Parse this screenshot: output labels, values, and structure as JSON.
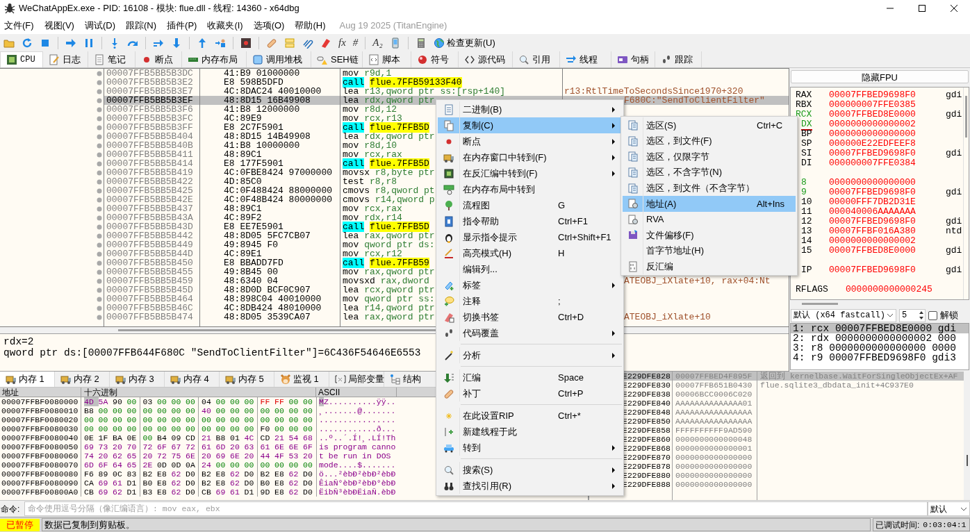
{
  "window": {
    "title": "WeChatAppEx.exe - PID: 16108 - 模块: flue.dll - 线程: 14360 - x64dbg"
  },
  "menu_bar": {
    "items": [
      "文件(F)",
      "视图(V)",
      "调试(D)",
      "跟踪(N)",
      "插件(P)",
      "收藏夹(I)",
      "选项(O)",
      "帮助(H)"
    ],
    "build_info": "Aug 19 2025 (TitanEngine)"
  },
  "toolbar": {
    "glyphs": [
      "fx",
      "#",
      "A₂"
    ],
    "update_button": "检查更新(U)"
  },
  "tabs": [
    {
      "label": "CPU",
      "selected": true
    },
    {
      "label": "日志",
      "selected": false
    },
    {
      "label": "笔记",
      "selected": false
    },
    {
      "label": "断点",
      "selected": false
    },
    {
      "label": "内存布局",
      "selected": false
    },
    {
      "label": "调用堆栈",
      "selected": false
    },
    {
      "label": "SEH链",
      "selected": false
    },
    {
      "label": "脚本",
      "selected": false
    },
    {
      "label": "符号",
      "selected": false
    },
    {
      "label": "源代码",
      "selected": false
    },
    {
      "label": "引用",
      "selected": false
    },
    {
      "label": "线程",
      "selected": false
    },
    {
      "label": "句柄",
      "selected": false
    },
    {
      "label": "跟踪",
      "selected": false
    }
  ],
  "disassembly": {
    "rows": [
      {
        "address": "00007FFB5BB5B3DC",
        "bytes": "41:B9 01000000",
        "kind": "plain",
        "mnemonic": "mov",
        "operands": "r9d,1",
        "selected": false
      },
      {
        "address": "00007FFB5BB5B3E2",
        "bytes": "E8 598B5DFD",
        "kind": "call",
        "mnemonic": "call",
        "operands": "flue.7FFB59133F40",
        "selected": false
      },
      {
        "address": "00007FFB5BB5B3E7",
        "bytes": "4C:8DAC24 40010000",
        "kind": "plain",
        "mnemonic": "lea",
        "operands": "r13,qword ptr ss:[rsp+140]",
        "comment": "r13:RtlTimeToSecondsSince1970+320",
        "selected": false
      },
      {
        "address": "00007FFB5BB5B3EF",
        "bytes": "48:8D15 16B49908",
        "kind": "plain",
        "mnemonic": "lea",
        "operands": "rdx,qword ptr",
        "comment": "F680C:\"SendToClientFilter\"",
        "selected": true
      },
      {
        "address": "00007FFB5BB5B3F6",
        "bytes": "41:B8 12000000",
        "kind": "plain",
        "mnemonic": "mov",
        "operands": "r8d,12",
        "selected": false
      },
      {
        "address": "00007FFB5BB5B3FC",
        "bytes": "4C:89E9",
        "kind": "plain",
        "mnemonic": "mov",
        "operands": "rcx,r13",
        "selected": false
      },
      {
        "address": "00007FFB5BB5B3FF",
        "bytes": "E8 2C7F5901",
        "kind": "call",
        "mnemonic": "call",
        "operands": "flue.7FFB5D",
        "selected": false
      },
      {
        "address": "00007FFB5BB5B404",
        "bytes": "48:8D15 14B49908",
        "kind": "plain",
        "mnemonic": "lea",
        "operands": "rdx,qword ptr",
        "selected": false
      },
      {
        "address": "00007FFB5BB5B40B",
        "bytes": "41:B8 10000000",
        "kind": "plain",
        "mnemonic": "mov",
        "operands": "r8d,10",
        "selected": false
      },
      {
        "address": "00007FFB5BB5B411",
        "bytes": "48:89C1",
        "kind": "plain",
        "mnemonic": "mov",
        "operands": "rcx,rax",
        "selected": false
      },
      {
        "address": "00007FFB5BB5B414",
        "bytes": "E8 177F5901",
        "kind": "call",
        "mnemonic": "call",
        "operands": "flue.7FFB5D",
        "selected": false
      },
      {
        "address": "00007FFB5BB5B419",
        "bytes": "4C:0FBE8424 97000000",
        "kind": "plain",
        "mnemonic": "movsx",
        "operands": "r8,byte ptr",
        "selected": false
      },
      {
        "address": "00007FFB5BB5B422",
        "bytes": "4D:85C0",
        "kind": "plain",
        "mnemonic": "test",
        "operands": "r8,r8",
        "selected": false
      },
      {
        "address": "00007FFB5BB5B425",
        "bytes": "4C:0F488424 88000000",
        "kind": "plain",
        "mnemonic": "cmovs",
        "operands": "r8,qword pt",
        "selected": false
      },
      {
        "address": "00007FFB5BB5B42E",
        "bytes": "4C:0F48B424 80000000",
        "kind": "plain",
        "mnemonic": "cmovs",
        "operands": "r14,qword p",
        "selected": false
      },
      {
        "address": "00007FFB5BB5B437",
        "bytes": "48:89C1",
        "kind": "plain",
        "mnemonic": "mov",
        "operands": "rcx,rax",
        "selected": false
      },
      {
        "address": "00007FFB5BB5B43A",
        "bytes": "4C:89F2",
        "kind": "plain",
        "mnemonic": "mov",
        "operands": "rdx,r14",
        "selected": false
      },
      {
        "address": "00007FFB5BB5B43D",
        "bytes": "E8 EE7E5901",
        "kind": "call",
        "mnemonic": "call",
        "operands": "flue.7FFB5D",
        "selected": false
      },
      {
        "address": "00007FFB5BB5B442",
        "bytes": "48:8D05 5FC7CB07",
        "kind": "plain",
        "mnemonic": "lea",
        "operands": "rax,qword ptr",
        "selected": false
      },
      {
        "address": "00007FFB5BB5B449",
        "bytes": "49:8945 F0",
        "kind": "plain",
        "mnemonic": "mov",
        "operands": "qword ptr ds:",
        "selected": false
      },
      {
        "address": "00007FFB5BB5B44D",
        "bytes": "4C:89E1",
        "kind": "plain",
        "mnemonic": "mov",
        "operands": "rcx,r12",
        "selected": false
      },
      {
        "address": "00007FFB5BB5B450",
        "bytes": "E8 BBADD7FD",
        "kind": "call",
        "mnemonic": "call",
        "operands": "flue.7FFB59",
        "selected": false
      },
      {
        "address": "00007FFB5BB5B455",
        "bytes": "49:8B45 00",
        "kind": "plain",
        "mnemonic": "mov",
        "operands": "rax,qword ptr",
        "selected": false
      },
      {
        "address": "00007FFB5BB5B459",
        "bytes": "48:6340 04",
        "kind": "plain",
        "mnemonic": "movsxd",
        "operands": "rax,dword",
        "comment": "ATEOBJ_iXlate+10, rax+04:Nt",
        "selected": false
      },
      {
        "address": "00007FFB5BB5B45D",
        "bytes": "48:8D0D BCF0C907",
        "kind": "plain",
        "mnemonic": "lea",
        "operands": "rcx,qword ptr",
        "selected": false
      },
      {
        "address": "00007FFB5BB5B464",
        "bytes": "48:898C04 40010000",
        "kind": "plain",
        "mnemonic": "mov",
        "operands": "qword ptr ss:",
        "selected": false
      },
      {
        "address": "00007FFB5BB5B46C",
        "bytes": "4C:8DB424 48010000",
        "kind": "plain",
        "mnemonic": "lea",
        "operands": "r14,qword ptr",
        "selected": false
      },
      {
        "address": "00007FFB5BB5B474",
        "bytes": "48:8D05 3539CA07",
        "kind": "plain",
        "mnemonic": "lea",
        "operands": "rax,qword ptr",
        "comment": "ATEOBJ_iXlate+10",
        "selected": false
      }
    ]
  },
  "registers": {
    "fpu_button": "隐藏FPU",
    "groups": [
      {
        "rows": [
          {
            "name": "RAX",
            "value": "00007FFBED9698F0",
            "comment": "gdi",
            "highlighted": false,
            "selected": false,
            "changed": true
          },
          {
            "name": "RBX",
            "value": "000000007FFE0385",
            "highlighted": false,
            "selected": false,
            "changed": true
          },
          {
            "name": "RCX",
            "value": "00007FFBED8E0000",
            "comment": "gdi",
            "highlighted": true,
            "selected": false,
            "changed": true
          },
          {
            "name": "DX",
            "value": "0000000000000002",
            "highlighted": true,
            "selected": true,
            "changed": true
          },
          {
            "name": "BP",
            "value": "0000000000000000",
            "highlighted": false,
            "selected": false,
            "changed": true
          },
          {
            "name": "SP",
            "value": "000000E22EDFEEF8",
            "highlighted": false,
            "selected": false,
            "changed": true
          },
          {
            "name": "SI",
            "value": "00007FFBED9698F0",
            "comment": "gdi",
            "highlighted": false,
            "selected": false,
            "changed": true
          },
          {
            "name": "DI",
            "value": "000000007FFE0384",
            "highlighted": false,
            "selected": false,
            "changed": true
          }
        ]
      },
      {
        "rows": [
          {
            "name": "8",
            "value": "0000000000000000",
            "highlighted": true,
            "selected": false,
            "changed": true
          },
          {
            "name": "9",
            "value": "00007FFBED9698F0",
            "comment": "gdi",
            "highlighted": true,
            "selected": false,
            "changed": true
          },
          {
            "name": "10",
            "value": "00000FFF7DB2D31E",
            "highlighted": false,
            "selected": false,
            "changed": true
          },
          {
            "name": "11",
            "value": "000040006AAAAAAA",
            "highlighted": false,
            "selected": false,
            "changed": true
          },
          {
            "name": "12",
            "value": "00007FFBED9698F0",
            "comment": "gdi",
            "highlighted": false,
            "selected": false,
            "changed": true
          },
          {
            "name": "13",
            "value": "00007FFBF016A380",
            "comment": "ntd",
            "highlighted": false,
            "selected": false,
            "changed": true
          },
          {
            "name": "14",
            "value": "0000000000000002",
            "highlighted": false,
            "selected": false,
            "changed": true
          },
          {
            "name": "15",
            "value": "00007FFBED8E0000",
            "comment": "gdi",
            "highlighted": false,
            "selected": false,
            "changed": true
          }
        ]
      },
      {
        "rows": [
          {
            "name": "IP",
            "value": "00007FFBED9698F0",
            "comment": "gdi",
            "highlighted": false,
            "selected": false,
            "changed": true
          }
        ]
      }
    ],
    "flags": {
      "name": "RFLAGS",
      "value": "0000000000000245"
    }
  },
  "call_convention": {
    "value": "默认 (x64 fastcall)",
    "count": "5",
    "unlock": {
      "label": "解锁",
      "checked": false
    },
    "args": [
      {
        "text": "1: rcx 00007FFBED8E0000 gdi",
        "selected": true
      },
      {
        "text": "2: rdx 0000000000000002 000",
        "selected": false
      },
      {
        "text": "3: r8 0000000000000000 0000",
        "selected": false
      },
      {
        "text": "4: r9 00007FFBED9698F0 gdi3",
        "selected": false
      }
    ]
  },
  "info_pane": {
    "lines": [
      "rdx=2",
      "qword ptr ds:[00007FFB644F680C \"SendToClientFilter\"]=6C436F54646E6553"
    ]
  },
  "memory_tabs": [
    {
      "label": "内存 1",
      "selected": true
    },
    {
      "label": "内存 2",
      "selected": false
    },
    {
      "label": "内存 3",
      "selected": false
    },
    {
      "label": "内存 4",
      "selected": false
    },
    {
      "label": "内存 5",
      "selected": false
    },
    {
      "label": "监视 1",
      "selected": false
    },
    {
      "label": "局部变量",
      "selected": false
    },
    {
      "label": "结构",
      "selected": false
    }
  ],
  "hex_dump": {
    "columns": [
      "地址",
      "十六进制",
      "ASCII"
    ],
    "rows": [
      {
        "address": "00007FFBF0080000",
        "bytes": "4D 5A 90 00 03 00 00 00 04 00 00 00 FF FF 00 00",
        "ascii": "MZ..........ÿÿ..",
        "cursor": true
      },
      {
        "address": "00007FFBF0080010",
        "bytes": "B8 00 00 00 00 00 00 00 40 00 00 00 00 00 00 00",
        "ascii": "¸.......@.......",
        "cursor": false
      },
      {
        "address": "00007FFBF0080020",
        "bytes": "00 00 00 00 00 00 00 00 00 00 00 00 00 00 00 00",
        "ascii": "................",
        "cursor": false
      },
      {
        "address": "00007FFBF0080030",
        "bytes": "00 00 00 00 00 00 00 00 00 00 00 00 F0 00 00 00",
        "ascii": "............ð...",
        "cursor": false
      },
      {
        "address": "00007FFBF0080040",
        "bytes": "0E 1F BA 0E 00 B4 09 CD 21 B8 01 4C CD 21 54 68",
        "ascii": "..º..´.Í!¸.LÍ!Th",
        "cursor": false
      },
      {
        "address": "00007FFBF0080050",
        "bytes": "69 73 20 70 72 6F 67 72 61 6D 20 63 61 6E 6E 6F",
        "ascii": "is program canno",
        "cursor": false
      },
      {
        "address": "00007FFBF0080060",
        "bytes": "74 20 62 65 20 72 75 6E 20 69 6E 20 44 4F 53 20",
        "ascii": "t be run in DOS",
        "cursor": false
      },
      {
        "address": "00007FFBF0080070",
        "bytes": "6D 6F 64 65 2E 0D 0D 0A 24 00 00 00 00 00 00 00",
        "ascii": "mode....$.......",
        "cursor": false
      },
      {
        "address": "00007FFBF0080080",
        "bytes": "F6 89 0C 83 B2 E8 62 D0 B2 E8 62 D0 B2 E8 62 D0",
        "ascii": "ö...²èbÐ²èbÐ²èbÐ",
        "cursor": false
      },
      {
        "address": "00007FFBF0080090",
        "bytes": "CA 69 61 D1 B0 E8 62 D0 B2 E8 62 D0 B0 E8 62 D0",
        "ascii": "ÊiaÑ°èbÐ²èbÐ°èbÐ",
        "cursor": false
      },
      {
        "address": "00007FFBF00800A0",
        "bytes": "CB 69 62 D1 B3 E8 62 D0 CB 69 61 D1 9D E8 62 D0",
        "ascii": "ËibÑ³èbÐËiaÑ.èbÐ",
        "cursor": false
      }
    ]
  },
  "stack": {
    "rows": [
      {
        "address": "E229DFE828",
        "value": "00007FFBED4F895F",
        "comment": "返回到 kernelbase.WaitForSingleObjectEx+AF",
        "selected": true
      },
      {
        "address": "E229DFE830",
        "value": "00007FFB651B0430",
        "comment": "flue.sqlite3_dbdata_init+4C937E0",
        "selected": false
      },
      {
        "address": "E229DFE838",
        "value": "00006BCC0006C020",
        "selected": false
      },
      {
        "address": "E229DFE840",
        "value": "AAAAAAAAAAAAAA01",
        "selected": false
      },
      {
        "address": "E229DFE848",
        "value": "AAAAAAAAAAAAAAAA",
        "selected": false
      },
      {
        "address": "E229DFE850",
        "value": "AAAAAAAAAAAAAAAA",
        "selected": false
      },
      {
        "address": "E229DFE858",
        "value": "FFFFFFFFFF9AD590",
        "selected": false
      },
      {
        "address": "E229DFE860",
        "value": "0000000000000048",
        "selected": false
      },
      {
        "address": "E229DFE868",
        "value": "0000000000000001",
        "selected": false
      },
      {
        "address": "E229DFE870",
        "value": "0000000000000000",
        "selected": false
      },
      {
        "address": "E229DFE878",
        "value": "0000000000000000",
        "selected": false
      },
      {
        "address": "E229DFE880",
        "value": "0000000000000000",
        "selected": false
      },
      {
        "address": "E229DFE888",
        "value": "0000000000000000",
        "selected": false
      }
    ]
  },
  "command_bar": {
    "label": "命令:",
    "placeholder": "命令使用逗号分隔（像汇编语言）: mov eax, ebx",
    "mode": "默认"
  },
  "status_bar": {
    "state": "已暂停",
    "message": "数据已复制到剪贴板。",
    "elapsed_label": "已调试时间:",
    "elapsed": "0:03:04:1"
  },
  "context_menu": {
    "items": [
      {
        "kind": "item",
        "label": "二进制(B)",
        "submenu": true,
        "selected": false
      },
      {
        "kind": "item",
        "label": "复制(C)",
        "submenu": true,
        "selected": true
      },
      {
        "kind": "item",
        "label": "断点",
        "submenu": true,
        "selected": false
      },
      {
        "kind": "item",
        "label": "在内存窗口中转到(F)",
        "submenu": true,
        "selected": false
      },
      {
        "kind": "item",
        "label": "在反汇编中转到(F)",
        "submenu": true,
        "selected": false
      },
      {
        "kind": "item",
        "label": "在内存布局中转到",
        "submenu": false,
        "selected": false
      },
      {
        "kind": "item",
        "label": "流程图",
        "shortcut": "G",
        "submenu": false,
        "selected": false
      },
      {
        "kind": "item",
        "label": "指令帮助",
        "shortcut": "Ctrl+F1",
        "submenu": false,
        "selected": false
      },
      {
        "kind": "item",
        "label": "显示指令提示",
        "shortcut": "Ctrl+Shift+F1",
        "submenu": false,
        "selected": false
      },
      {
        "kind": "item",
        "label": "高亮模式(H)",
        "shortcut": "H",
        "submenu": false,
        "selected": false
      },
      {
        "kind": "item",
        "label": "编辑列...",
        "submenu": false,
        "selected": false
      },
      {
        "kind": "item",
        "label": "标签",
        "submenu": true,
        "selected": false
      },
      {
        "kind": "item",
        "label": "注释",
        "shortcut": ";",
        "submenu": false,
        "selected": false
      },
      {
        "kind": "item",
        "label": "切换书签",
        "shortcut": "Ctrl+D",
        "submenu": false,
        "selected": false
      },
      {
        "kind": "item",
        "label": "代码覆盖",
        "submenu": true,
        "selected": false
      },
      {
        "kind": "separator"
      },
      {
        "kind": "item",
        "label": "分析",
        "submenu": true,
        "selected": false
      },
      {
        "kind": "separator"
      },
      {
        "kind": "item",
        "label": "汇编",
        "shortcut": "Space",
        "submenu": false,
        "selected": false
      },
      {
        "kind": "item",
        "label": "补丁",
        "shortcut": "Ctrl+P",
        "submenu": false,
        "selected": false
      },
      {
        "kind": "separator"
      },
      {
        "kind": "item",
        "label": "在此设置RIP",
        "shortcut": "Ctrl+*",
        "submenu": false,
        "selected": false
      },
      {
        "kind": "item",
        "label": "新建线程于此",
        "submenu": false,
        "selected": false
      },
      {
        "kind": "item",
        "label": "转到",
        "submenu": true,
        "selected": false
      },
      {
        "kind": "separator"
      },
      {
        "kind": "item",
        "label": "搜索(S)",
        "submenu": true,
        "selected": false
      },
      {
        "kind": "item",
        "label": "查找引用(R)",
        "submenu": true,
        "selected": false
      }
    ]
  },
  "copy_submenu": {
    "items": [
      {
        "label": "选区(S)",
        "shortcut": "Ctrl+C",
        "selected": false
      },
      {
        "label": "选区，到文件(F)",
        "selected": false
      },
      {
        "label": "选区，仅限字节",
        "selected": false
      },
      {
        "label": "选区，不含字节(N)",
        "selected": false
      },
      {
        "label": "选区，到文件（不含字节）",
        "selected": false
      },
      {
        "label": "地址(A)",
        "shortcut": "Alt+Ins",
        "selected": true
      },
      {
        "label": "RVA",
        "selected": false
      },
      {
        "label": "文件偏移(F)",
        "selected": false
      },
      {
        "label": "首字节地址(H)",
        "selected": false
      },
      {
        "label": "反汇编",
        "selected": false
      }
    ]
  }
}
